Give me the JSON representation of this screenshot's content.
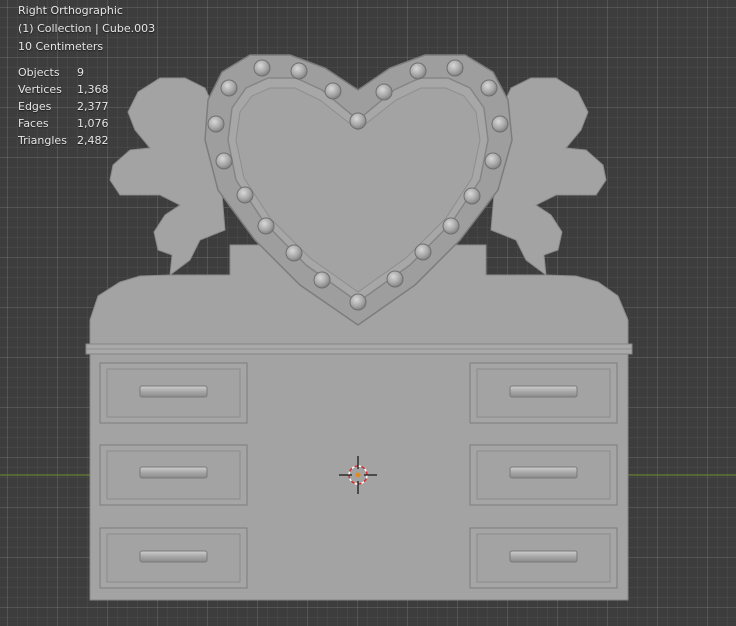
{
  "viewport": {
    "view_name": "Right Orthographic",
    "collection_line": "(1) Collection | Cube.003",
    "scale_line": "10 Centimeters"
  },
  "stats": [
    {
      "label": "Objects",
      "value": "9"
    },
    {
      "label": "Vertices",
      "value": "1,368"
    },
    {
      "label": "Edges",
      "value": "2,377"
    },
    {
      "label": "Faces",
      "value": "1,076"
    },
    {
      "label": "Triangles",
      "value": "2,482"
    }
  ],
  "colors": {
    "background": "#3d3d3d",
    "axis_line": "#6e8f2a",
    "model": "#a3a3a3",
    "model_dark": "#7d7d7d",
    "overlay_text": "#e6e6e6"
  },
  "icons": [
    "3d-cursor-icon"
  ]
}
